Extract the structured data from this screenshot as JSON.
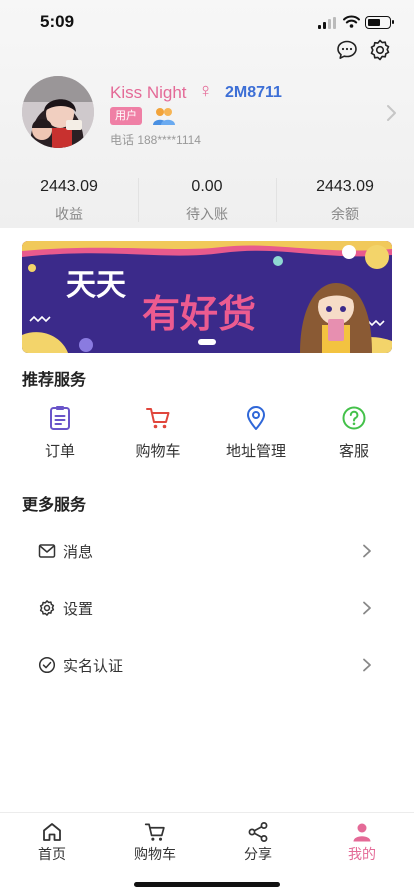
{
  "status_bar": {
    "time": "5:09"
  },
  "profile": {
    "name": "Kiss Night",
    "gender_symbol": "♀",
    "uid": "2M8711",
    "role_badge": "用户",
    "phone": "电话 188****1114"
  },
  "stats": [
    {
      "value": "2443.09",
      "label": "收益"
    },
    {
      "value": "0.00",
      "label": "待入账"
    },
    {
      "value": "2443.09",
      "label": "余额"
    }
  ],
  "banner": {
    "text_left": "天天",
    "text_right": "有好货"
  },
  "recommended": {
    "title": "推荐服务",
    "items": [
      {
        "label": "订单",
        "icon": "order-list-icon"
      },
      {
        "label": "购物车",
        "icon": "cart-icon"
      },
      {
        "label": "地址管理",
        "icon": "location-pin-icon"
      },
      {
        "label": "客服",
        "icon": "help-circle-icon"
      }
    ]
  },
  "more": {
    "title": "更多服务",
    "items": [
      {
        "label": "消息",
        "icon": "mail-icon"
      },
      {
        "label": "设置",
        "icon": "gear-icon"
      },
      {
        "label": "实名认证",
        "icon": "check-circle-icon"
      }
    ]
  },
  "tabbar": {
    "items": [
      {
        "label": "首页",
        "icon": "home-icon"
      },
      {
        "label": "购物车",
        "icon": "cart-icon"
      },
      {
        "label": "分享",
        "icon": "share-icon"
      },
      {
        "label": "我的",
        "icon": "user-icon"
      }
    ],
    "active_index": 3
  },
  "colors": {
    "accent_pink": "#e46a97",
    "uid_blue": "#3d6fd6",
    "order_purple": "#6a55c9",
    "cart_red": "#e0463c",
    "location_blue": "#2f67d8",
    "help_green": "#44c14a",
    "banner_purple": "#3b2a8a"
  }
}
